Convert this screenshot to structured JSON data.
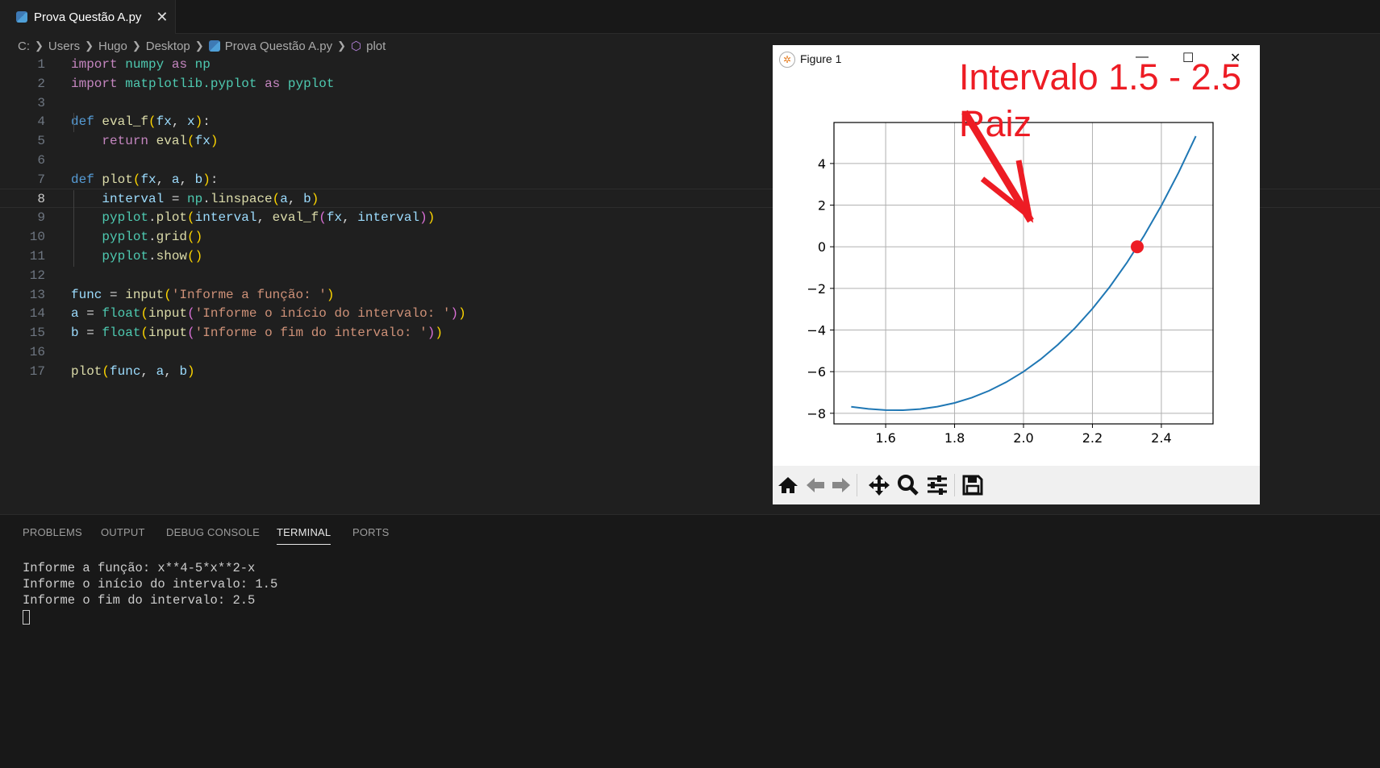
{
  "editor": {
    "tab": {
      "label": "Prova Questão A.py",
      "close": "✕"
    },
    "breadcrumb": [
      "C:",
      "Users",
      "Hugo",
      "Desktop",
      "Prova Questão A.py",
      "plot"
    ],
    "active_line": 8,
    "lines": [
      [
        [
          "import",
          "kw"
        ],
        [
          " ",
          ""
        ],
        [
          "numpy",
          "mod"
        ],
        [
          " ",
          ""
        ],
        [
          "as",
          "kw"
        ],
        [
          " ",
          ""
        ],
        [
          "np",
          "mod"
        ]
      ],
      [
        [
          "import",
          "kw"
        ],
        [
          " ",
          ""
        ],
        [
          "matplotlib.pyplot",
          "mod"
        ],
        [
          " ",
          ""
        ],
        [
          "as",
          "kw"
        ],
        [
          " ",
          ""
        ],
        [
          "pyplot",
          "mod"
        ]
      ],
      [],
      [
        [
          "def",
          "def"
        ],
        [
          " ",
          ""
        ],
        [
          "eval_f",
          "fn"
        ],
        [
          "(",
          "b1"
        ],
        [
          "fx",
          "var"
        ],
        [
          ", ",
          "op"
        ],
        [
          "x",
          "var"
        ],
        [
          ")",
          "b1"
        ],
        [
          ":",
          "op"
        ]
      ],
      [
        [
          "    ",
          ""
        ],
        [
          "return",
          "kw"
        ],
        [
          " ",
          ""
        ],
        [
          "eval",
          "fn"
        ],
        [
          "(",
          "b1"
        ],
        [
          "fx",
          "var"
        ],
        [
          ")",
          "b1"
        ]
      ],
      [],
      [
        [
          "def",
          "def"
        ],
        [
          " ",
          ""
        ],
        [
          "plot",
          "fn"
        ],
        [
          "(",
          "b1"
        ],
        [
          "fx",
          "var"
        ],
        [
          ", ",
          "op"
        ],
        [
          "a",
          "var"
        ],
        [
          ", ",
          "op"
        ],
        [
          "b",
          "var"
        ],
        [
          ")",
          "b1"
        ],
        [
          ":",
          "op"
        ]
      ],
      [
        [
          "    ",
          ""
        ],
        [
          "interval",
          "var"
        ],
        [
          " = ",
          "op"
        ],
        [
          "np",
          "mod"
        ],
        [
          ".",
          "op"
        ],
        [
          "linspace",
          "fn"
        ],
        [
          "(",
          "b1"
        ],
        [
          "a",
          "var"
        ],
        [
          ", ",
          "op"
        ],
        [
          "b",
          "var"
        ],
        [
          ")",
          "b1"
        ]
      ],
      [
        [
          "    ",
          ""
        ],
        [
          "pyplot",
          "mod"
        ],
        [
          ".",
          "op"
        ],
        [
          "plot",
          "fn"
        ],
        [
          "(",
          "b1"
        ],
        [
          "interval",
          "var"
        ],
        [
          ", ",
          "op"
        ],
        [
          "eval_f",
          "fn"
        ],
        [
          "(",
          "b2"
        ],
        [
          "fx",
          "var"
        ],
        [
          ", ",
          "op"
        ],
        [
          "interval",
          "var"
        ],
        [
          ")",
          "b2"
        ],
        [
          ")",
          "b1"
        ]
      ],
      [
        [
          "    ",
          ""
        ],
        [
          "pyplot",
          "mod"
        ],
        [
          ".",
          "op"
        ],
        [
          "grid",
          "fn"
        ],
        [
          "()",
          "b1"
        ]
      ],
      [
        [
          "    ",
          ""
        ],
        [
          "pyplot",
          "mod"
        ],
        [
          ".",
          "op"
        ],
        [
          "show",
          "fn"
        ],
        [
          "()",
          "b1"
        ]
      ],
      [],
      [
        [
          "func",
          "var"
        ],
        [
          " = ",
          "op"
        ],
        [
          "input",
          "fn"
        ],
        [
          "(",
          "b1"
        ],
        [
          "'Informe a função: '",
          "str"
        ],
        [
          ")",
          "b1"
        ]
      ],
      [
        [
          "a",
          "var"
        ],
        [
          " = ",
          "op"
        ],
        [
          "float",
          "mod"
        ],
        [
          "(",
          "b1"
        ],
        [
          "input",
          "fn"
        ],
        [
          "(",
          "b2"
        ],
        [
          "'Informe o início do intervalo: '",
          "str"
        ],
        [
          ")",
          "b2"
        ],
        [
          ")",
          "b1"
        ]
      ],
      [
        [
          "b",
          "var"
        ],
        [
          " = ",
          "op"
        ],
        [
          "float",
          "mod"
        ],
        [
          "(",
          "b1"
        ],
        [
          "input",
          "fn"
        ],
        [
          "(",
          "b2"
        ],
        [
          "'Informe o fim do intervalo: '",
          "str"
        ],
        [
          ")",
          "b2"
        ],
        [
          ")",
          "b1"
        ]
      ],
      [],
      [
        [
          "plot",
          "fn"
        ],
        [
          "(",
          "b1"
        ],
        [
          "func",
          "var"
        ],
        [
          ", ",
          "op"
        ],
        [
          "a",
          "var"
        ],
        [
          ", ",
          "op"
        ],
        [
          "b",
          "var"
        ],
        [
          ")",
          "b1"
        ]
      ]
    ]
  },
  "panel": {
    "tabs": [
      "PROBLEMS",
      "OUTPUT",
      "DEBUG CONSOLE",
      "TERMINAL",
      "PORTS"
    ],
    "active_tab": "TERMINAL",
    "terminal": [
      "Informe a função: x**4-5*x**2-x",
      "Informe o início do intervalo: 1.5",
      "Informe o fim do intervalo: 2.5"
    ]
  },
  "figure": {
    "title": "Figure 1",
    "controls": {
      "minimize": "—",
      "maximize": "☐",
      "close": "✕"
    },
    "toolbar": [
      "home-icon",
      "back-icon",
      "forward-icon",
      "pan-icon",
      "zoom-icon",
      "configure-subplots-icon",
      "save-icon"
    ],
    "annotations": {
      "title": "Intervalo 1.5 - 2.5",
      "root_label": "Raiz",
      "color": "#ed1c24"
    }
  },
  "chart_data": {
    "type": "line",
    "x": [
      1.5,
      1.55,
      1.6,
      1.65,
      1.7,
      1.75,
      1.8,
      1.85,
      1.9,
      1.95,
      2.0,
      2.05,
      2.1,
      2.15,
      2.2,
      2.25,
      2.3,
      2.35,
      2.4,
      2.45,
      2.5
    ],
    "y": [
      -7.6875,
      -7.7905,
      -7.8464,
      -7.8505,
      -7.7979,
      -7.6836,
      -7.5024,
      -7.249,
      -6.9179,
      -6.5035,
      -6.0,
      -5.4015,
      -4.7019,
      -3.895,
      -2.9744,
      -1.9336,
      -0.7659,
      0.5355,
      1.9776,
      3.5675,
      5.3125
    ],
    "xlim": [
      1.45,
      2.55
    ],
    "ylim": [
      -8.51,
      5.97
    ],
    "xticks": [
      "1.6",
      "1.8",
      "2.0",
      "2.2",
      "2.4"
    ],
    "yticks": [
      "4",
      "2",
      "0",
      "−2",
      "−4",
      "−6",
      "−8"
    ],
    "grid": true,
    "line_color": "#1f77b4",
    "root_marker": {
      "x": 2.33,
      "y": 0
    }
  }
}
